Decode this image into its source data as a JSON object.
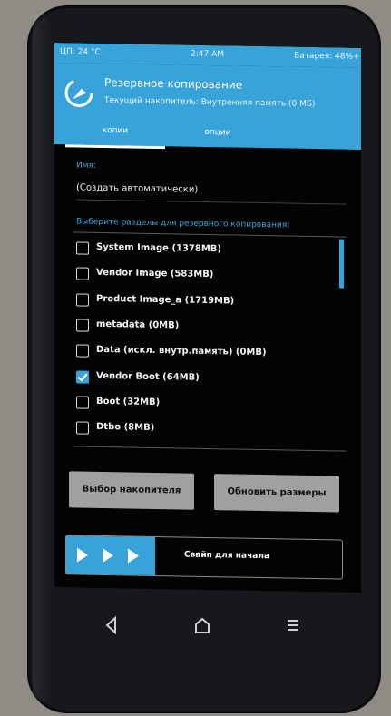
{
  "status_bar": {
    "cpu": "ЦП: 24 °C",
    "time": "2:47 AM",
    "battery": "Батарея: 48%+"
  },
  "header": {
    "title": "Резервное копирование",
    "subtitle": "Текущий накопитель: Внутренняя память (0 МБ)",
    "logo_icon": "twrp-logo-icon",
    "accent_color": "#37a3d9"
  },
  "tabs": [
    {
      "label": "копии",
      "active": true
    },
    {
      "label": "опции",
      "active": false
    }
  ],
  "name_field": {
    "label": "Имя:",
    "value": "(Создать автоматически)"
  },
  "partitions": {
    "label": "Выберите разделы для резервного копирования:",
    "items": [
      {
        "label": "System Image (1378MB)",
        "checked": false
      },
      {
        "label": "Vendor Image (583MB)",
        "checked": false
      },
      {
        "label": "Product Image_a (1719MB)",
        "checked": false
      },
      {
        "label": "metadata (0MB)",
        "checked": false
      },
      {
        "label": "Data (искл. внутр.память) (0MB)",
        "checked": false
      },
      {
        "label": "Vendor Boot (64MB)",
        "checked": true
      },
      {
        "label": "Boot (32MB)",
        "checked": false
      },
      {
        "label": "Dtbo (8MB)",
        "checked": false
      }
    ]
  },
  "buttons": {
    "select_storage": "Выбор накопителя",
    "refresh_sizes": "Обновить размеры"
  },
  "slider": {
    "label": "Свайп для начала"
  },
  "nav_bar": {
    "back_icon": "back-icon",
    "home_icon": "home-icon",
    "menu_icon": "menu-icon"
  }
}
